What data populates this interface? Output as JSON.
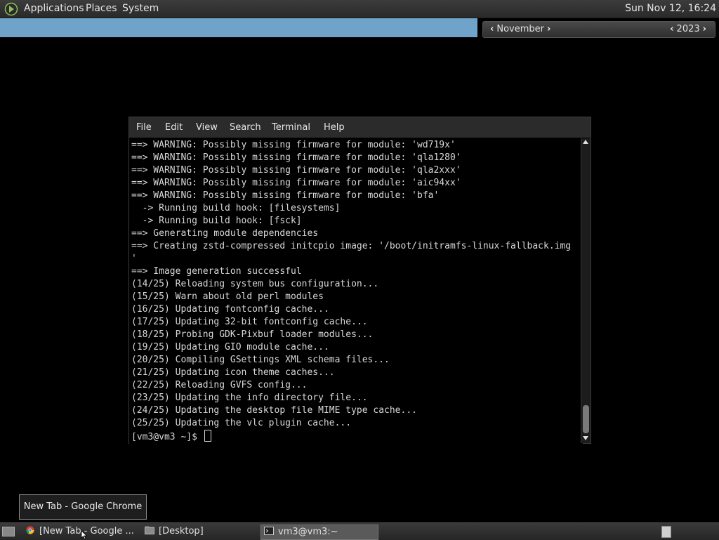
{
  "top_panel": {
    "menus": [
      "Applications",
      "Places",
      "System"
    ],
    "clock": "Sun Nov 12, 16:24"
  },
  "calendar": {
    "month": "November",
    "year": "2023"
  },
  "terminal": {
    "menu": [
      "File",
      "Edit",
      "View",
      "Search",
      "Terminal",
      "Help"
    ],
    "lines": [
      "==> WARNING: Possibly missing firmware for module: 'wd719x'",
      "==> WARNING: Possibly missing firmware for module: 'qla1280'",
      "==> WARNING: Possibly missing firmware for module: 'qla2xxx'",
      "==> WARNING: Possibly missing firmware for module: 'aic94xx'",
      "==> WARNING: Possibly missing firmware for module: 'bfa'",
      "  -> Running build hook: [filesystems]",
      "  -> Running build hook: [fsck]",
      "==> Generating module dependencies",
      "==> Creating zstd-compressed initcpio image: '/boot/initramfs-linux-fallback.img",
      "'",
      "==> Image generation successful",
      "(14/25) Reloading system bus configuration...",
      "(15/25) Warn about old perl modules",
      "(16/25) Updating fontconfig cache...",
      "(17/25) Updating 32-bit fontconfig cache...",
      "(18/25) Probing GDK-Pixbuf loader modules...",
      "(19/25) Updating GIO module cache...",
      "(20/25) Compiling GSettings XML schema files...",
      "(21/25) Updating icon theme caches...",
      "(22/25) Reloading GVFS config...",
      "(23/25) Updating the info directory file...",
      "(24/25) Updating the desktop file MIME type cache...",
      "(25/25) Updating the vlc plugin cache..."
    ],
    "prompt": "[vm3@vm3 ~]$ "
  },
  "tooltip": "New Tab - Google Chrome",
  "taskbar": {
    "tasks": [
      {
        "label": "[New Tab - Google ...",
        "icon": "chrome-icon"
      },
      {
        "label": "[Desktop]",
        "icon": "folder-icon"
      },
      {
        "label": "vm3@vm3:~",
        "icon": "terminal-icon"
      }
    ]
  }
}
